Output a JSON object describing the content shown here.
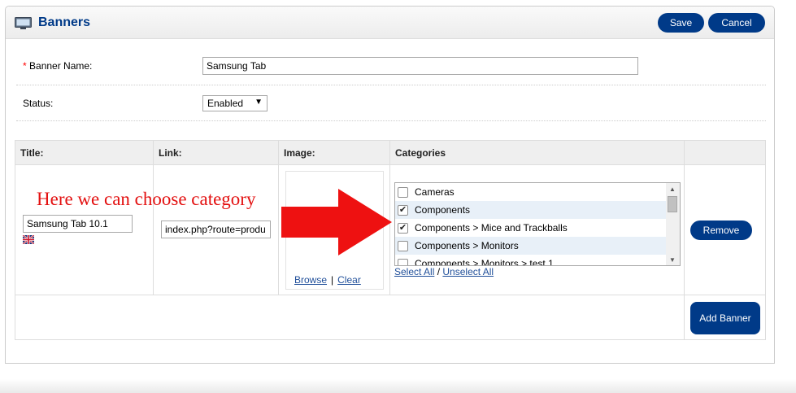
{
  "header": {
    "title": "Banners",
    "icon": "monitor-icon",
    "save_label": "Save",
    "cancel_label": "Cancel"
  },
  "form": {
    "banner_name_label": "Banner Name:",
    "required_marker": "*",
    "banner_name_value": "Samsung Tab",
    "status_label": "Status:",
    "status_value": "Enabled"
  },
  "table": {
    "headers": [
      "Title:",
      "Link:",
      "Image:",
      "Categories",
      ""
    ],
    "row": {
      "title_value": "Samsung Tab 10.1",
      "link_value": "index.php?route=produ",
      "browse_label": "Browse",
      "image_separator": "|",
      "clear_label": "Clear",
      "categories": [
        {
          "label": "Cameras",
          "checked": false
        },
        {
          "label": "Components",
          "checked": true
        },
        {
          "label": "Components > Mice and Trackballs",
          "checked": true
        },
        {
          "label": "Components > Monitors",
          "checked": false
        },
        {
          "label": "Components > Monitors > test 1",
          "checked": false
        }
      ],
      "select_all_label": "Select All",
      "select_separator": "/",
      "unselect_all_label": "Unselect All",
      "remove_label": "Remove"
    },
    "add_banner_label": "Add Banner"
  },
  "annotation": {
    "text": "Here we can choose category",
    "color": "#e31010"
  },
  "colors": {
    "accent": "#003a88",
    "link": "#1f4e99"
  }
}
